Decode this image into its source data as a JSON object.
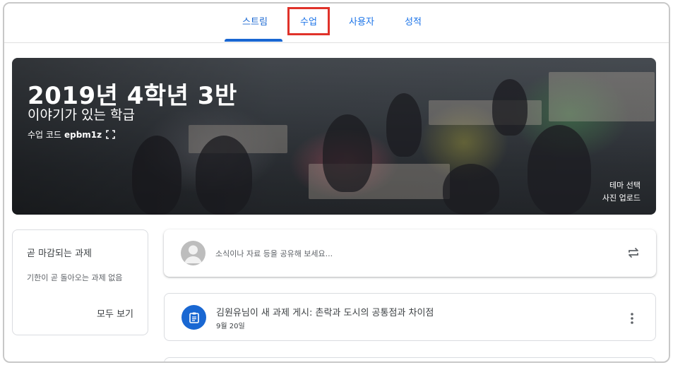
{
  "tabs": [
    {
      "label": "스트림"
    },
    {
      "label": "수업"
    },
    {
      "label": "사용자"
    },
    {
      "label": "성적"
    }
  ],
  "banner": {
    "title": "2019년 4학년 3반",
    "subtitle": "이야기가 있는 학급",
    "code_label": "수업 코드",
    "code_value": "epbm1z",
    "theme_link": "테마 선택",
    "upload_link": "사진 업로드"
  },
  "upcoming": {
    "title": "곧 마감되는 과제",
    "description": "기한이 곧 돌아오는 과제 없음",
    "view_all": "모두 보기"
  },
  "share": {
    "placeholder": "소식이나 자료 등을 공유해 보세요...",
    "icon": "repost-icon"
  },
  "posts": [
    {
      "title": "김원유님이 새 과제 게시: 촌락과 도시의 공통점과 차이점",
      "date": "9월 20일",
      "icon": "assignment-icon"
    }
  ],
  "colors": {
    "accent": "#1967d2",
    "highlight": "#e0322a"
  }
}
